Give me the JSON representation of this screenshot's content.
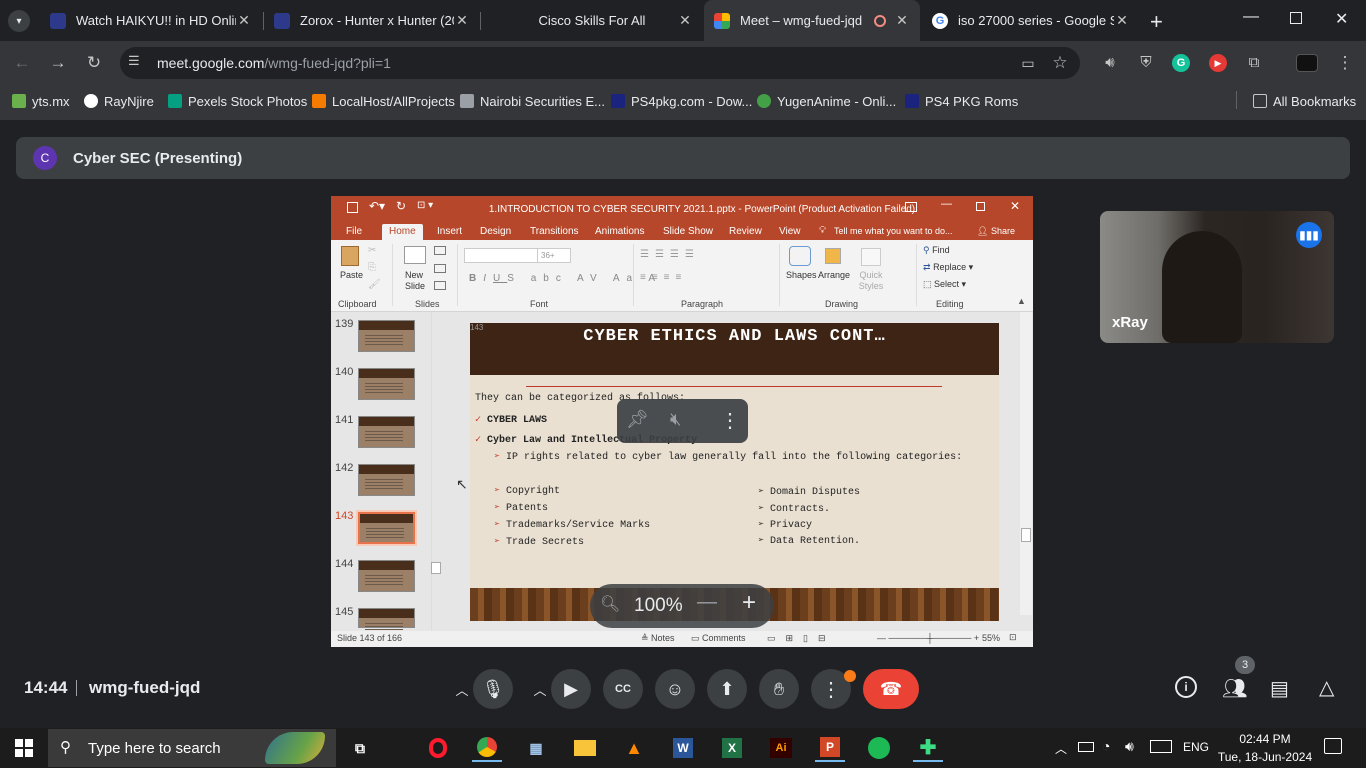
{
  "browser": {
    "tabs": [
      {
        "title": "Watch HAIKYU!! in HD Onlin",
        "active": false
      },
      {
        "title": "Zorox - Hunter x Hunter (20",
        "active": false
      },
      {
        "title": "Cisco Skills For All",
        "active": false
      },
      {
        "title": "Meet – wmg-fued-jqd",
        "active": true
      },
      {
        "title": "iso 27000 series - Google Se",
        "active": false
      }
    ],
    "url_domain": "meet.google.com",
    "url_path": "/wmg-fued-jqd?pli=1",
    "bookmarks": [
      "yts.mx",
      "RayNjire",
      "Pexels Stock Photos",
      "LocalHost/AllProjects",
      "Nairobi Securities E...",
      "PS4pkg.com - Dow...",
      "YugenAnime - Onli...",
      "PS4 PKG Roms"
    ],
    "all_bookmarks": "All Bookmarks"
  },
  "meet": {
    "presenter_initial": "C",
    "presenter_label": "Cyber SEC (Presenting)",
    "self_name": "xRay",
    "time": "14:44",
    "meeting_code": "wmg-fued-jqd",
    "participants_count": "3",
    "zoom_level": "100%"
  },
  "powerpoint": {
    "title": "1.INTRODUCTION TO CYBER SECURITY 2021.1.pptx - PowerPoint (Product Activation Failed)",
    "tabs": [
      "File",
      "Home",
      "Insert",
      "Design",
      "Transitions",
      "Animations",
      "Slide Show",
      "Review",
      "View"
    ],
    "tell_me": "Tell me what you want to do...",
    "share": "Share",
    "groups": [
      "Clipboard",
      "Slides",
      "Font",
      "Paragraph",
      "Drawing",
      "Editing"
    ],
    "labels": {
      "paste": "Paste",
      "new_slide": "New Slide",
      "shapes": "Shapes",
      "arrange": "Arrange",
      "quick_styles": "Quick Styles",
      "find": "Find",
      "replace": "Replace",
      "select": "Select",
      "font_size": "36+"
    },
    "thumb_numbers": [
      "139",
      "140",
      "141",
      "142",
      "143",
      "144",
      "145"
    ],
    "status_slide": "Slide 143 of 166",
    "status_notes": "Notes",
    "status_comments": "Comments",
    "status_zoom": "55%"
  },
  "slide": {
    "number": "143",
    "title": "CYBER ETHICS AND LAWS CONT…",
    "intro": "They can be categorized as follows:",
    "b1": "CYBER LAWS",
    "b2": "Cyber Law and Intellectual Property",
    "sub": "IP rights related to cyber law generally fall into the following categories:",
    "left_items": [
      "Copyright",
      "Patents",
      "Trademarks/Service Marks",
      "Trade Secrets"
    ],
    "right_items": [
      "Domain Disputes",
      "Contracts.",
      "Privacy",
      "Data Retention."
    ]
  },
  "taskbar": {
    "search_placeholder": "Type here to search",
    "lang": "ENG",
    "time": "02:44 PM",
    "date": "Tue, 18-Jun-2024"
  },
  "colors": {
    "ppt_red": "#b7472a",
    "end_call": "#ea4335",
    "meet_bg": "#202124"
  }
}
